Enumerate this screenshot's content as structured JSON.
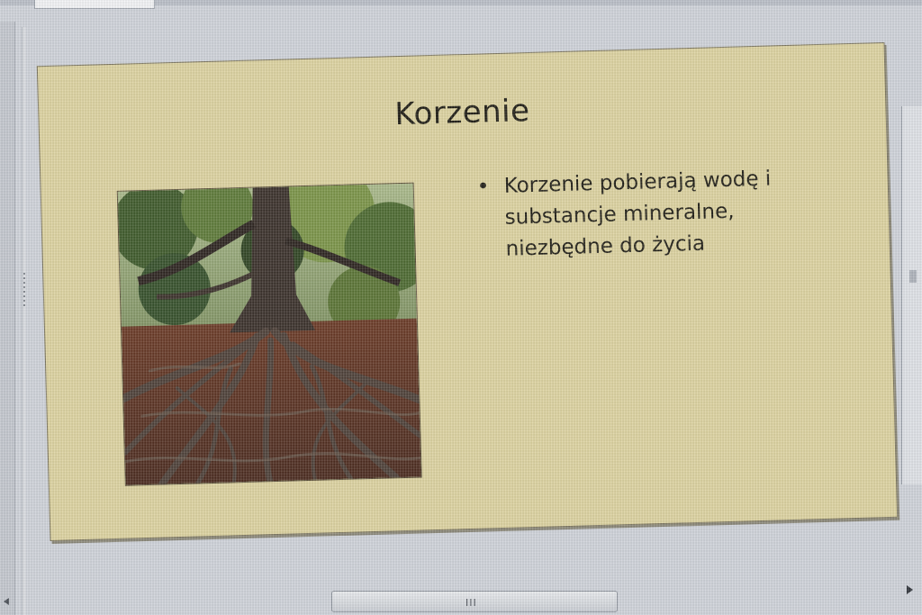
{
  "slide": {
    "title": "Korzenie",
    "bullets": [
      "Korzenie pobierają wodę i substancje mineralne, niezbędne do życia"
    ],
    "image_description_icon": "tree-roots-photo"
  },
  "scrollbar": {
    "grip_glyph": "III"
  },
  "colors": {
    "slide_background": "#ddd3a0",
    "title_text": "#1c1a12",
    "app_background": "#cfd3da"
  }
}
